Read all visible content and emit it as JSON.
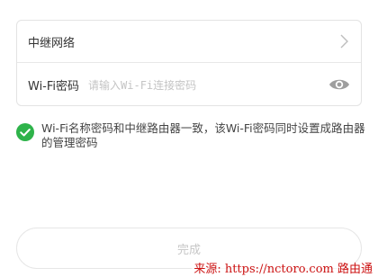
{
  "settings_card": {
    "relay_network_label": "中继网络",
    "wifi_password_label": "Wi-Fi密码",
    "wifi_password_placeholder": "请输入Wi-Fi连接密码",
    "wifi_password_value": ""
  },
  "sync_option": {
    "checked": true,
    "text": "Wi-Fi名称密码和中继路由器一致，该Wi-Fi密码同时设置成路由器的管理密码",
    "accent_color": "#2eb34a"
  },
  "done_button": {
    "label": "完成"
  },
  "watermark": {
    "text": "来源: https://nctoro.com 路由通"
  },
  "icons": {
    "relay_row": "chevron-right-icon",
    "password_row": "eye-icon",
    "sync_option": "check-circle-icon"
  }
}
